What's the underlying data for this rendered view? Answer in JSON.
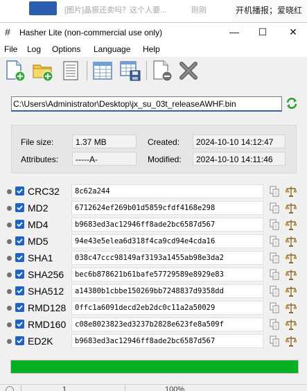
{
  "background": {
    "notification_text": "[图片]晶振还卖吗？这个人要...",
    "notification_time": "刚刚",
    "right_text": "开机播报；爱晓红"
  },
  "window": {
    "title": "Hasher Lite (non-commercial use only)",
    "minimize": "—",
    "maximize": "☐",
    "close": "✕"
  },
  "menu": [
    "File",
    "Log",
    "Options",
    "Language",
    "Help"
  ],
  "toolbar_icons": [
    "add-file-icon",
    "add-folder-icon",
    "text-document-icon",
    "table-icon",
    "save-table-icon",
    "remove-file-icon",
    "clear-x-icon"
  ],
  "file": {
    "path": "C:\\Users\\Administrator\\Desktop\\jx_su_03t_releaseAWHF.bin",
    "size_label": "File size:",
    "size": "1.37 MB",
    "attributes_label": "Attributes:",
    "attributes": "-----A-",
    "created_label": "Created:",
    "created": "2024-10-10 14:12:47",
    "modified_label": "Modified:",
    "modified": "2024-10-10 14:11:46"
  },
  "hashes": [
    {
      "name": "CRC32",
      "value": "8c62a244"
    },
    {
      "name": "MD2",
      "value": "6712624ef269b01d5859cfdf4168e298"
    },
    {
      "name": "MD4",
      "value": "b9683ed3ac12946ff8ade2bc6587d567"
    },
    {
      "name": "MD5",
      "value": "94e43e5elea6d318f4ca9cd94e4cda16"
    },
    {
      "name": "SHA1",
      "value": "038c47ccc98149af3193a1455ab98e3da2"
    },
    {
      "name": "SHA256",
      "value": "bec6b878621b61bafe57729589e8929e83"
    },
    {
      "name": "SHA512",
      "value": "a14380b1cbbe150269bb7248837d9358dd"
    },
    {
      "name": "RMD128",
      "value": "0ffc1a6091decd2eb2dc0c11a2a50029"
    },
    {
      "name": "RMD160",
      "value": "c08e8023823ed3237b2828e623fe8a509f"
    },
    {
      "name": "ED2K",
      "value": "b9683ed3ac12946ff8ade2bc6587d567"
    }
  ],
  "progress": 1.0,
  "progress_color": "#06b025",
  "status": {
    "count": "1",
    "percent": "100%"
  },
  "colors": {
    "checkbox": "#1f63c6",
    "accent_underline": "#3060b0"
  }
}
